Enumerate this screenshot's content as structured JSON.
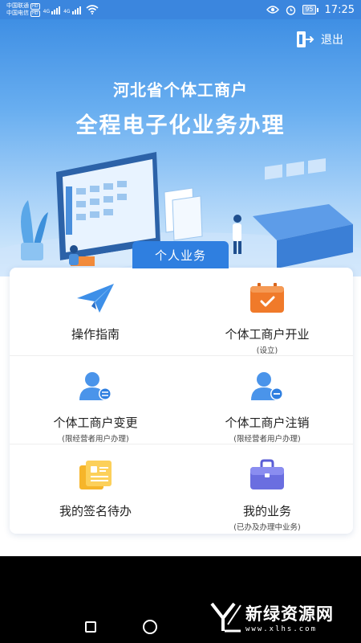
{
  "status_bar": {
    "carrier1": "中国联通",
    "carrier2": "中国电信",
    "hd": "HD",
    "net1": "4G",
    "net2": "4G",
    "battery": "95",
    "time": "17:25"
  },
  "header": {
    "logout_label": "退出",
    "title_line1": "河北省个体工商户",
    "title_line2": "全程电子化业务办理"
  },
  "tab": {
    "label": "个人业务"
  },
  "menu": [
    {
      "label": "操作指南",
      "sub": "",
      "icon": "paper-plane-icon"
    },
    {
      "label": "个体工商户开业",
      "sub": "(设立)",
      "icon": "checklist-folder-icon"
    },
    {
      "label": "个体工商户变更",
      "sub": "(限经营者用户办理)",
      "icon": "user-change-icon"
    },
    {
      "label": "个体工商户注销",
      "sub": "(限经营者用户办理)",
      "icon": "user-cancel-icon"
    },
    {
      "label": "我的签名待办",
      "sub": "",
      "icon": "signature-document-icon"
    },
    {
      "label": "我的业务",
      "sub": "(已办及办理中业务)",
      "icon": "briefcase-icon"
    }
  ],
  "watermark": {
    "name": "新绿资源网",
    "url": "www.xlhs.com"
  },
  "colors": {
    "primary": "#2f7fe0",
    "orange": "#f07a2a",
    "purple": "#6a6ee0"
  }
}
